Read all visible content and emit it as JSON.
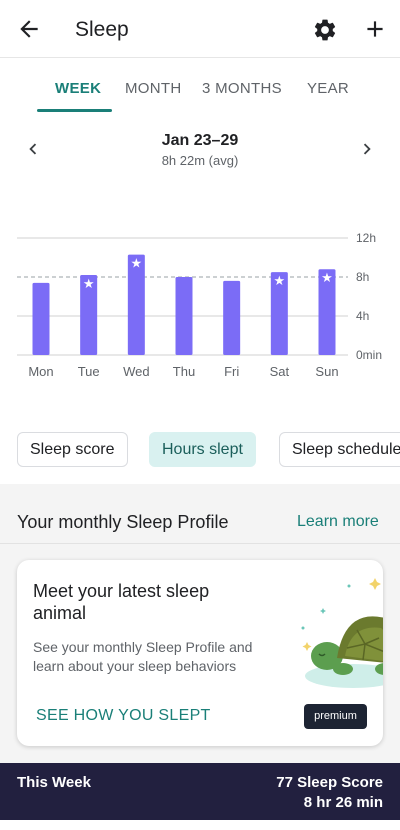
{
  "header": {
    "title": "Sleep"
  },
  "tabs": [
    {
      "label": "WEEK",
      "active": true
    },
    {
      "label": "MONTH",
      "active": false
    },
    {
      "label": "3 MONTHS",
      "active": false
    },
    {
      "label": "YEAR",
      "active": false
    }
  ],
  "range": {
    "label": "Jan 23–29",
    "avg": "8h 22m (avg)"
  },
  "chart_data": {
    "type": "bar",
    "categories": [
      "Mon",
      "Tue",
      "Wed",
      "Thu",
      "Fri",
      "Sat",
      "Sun"
    ],
    "values": [
      7.4,
      8.2,
      10.3,
      8.0,
      7.6,
      8.5,
      8.8
    ],
    "starred": [
      false,
      true,
      true,
      false,
      false,
      true,
      true
    ],
    "y_ticks": [
      "0min",
      "4h",
      "8h",
      "12h"
    ],
    "y_tick_values": [
      0,
      4,
      8,
      12
    ],
    "ylim": [
      0,
      12
    ],
    "reference_line": 8,
    "bar_color": "#7b6cf6",
    "grid": true
  },
  "chips": [
    {
      "label": "Sleep score",
      "active": false
    },
    {
      "label": "Hours slept",
      "active": true
    },
    {
      "label": "Sleep schedule",
      "active": false
    }
  ],
  "profile": {
    "title": "Your monthly Sleep Profile",
    "learn_more": "Learn more"
  },
  "card": {
    "heading": "Meet your latest sleep animal",
    "description": "See your monthly Sleep Profile and learn about your sleep behaviors",
    "cta": "SEE HOW YOU SLEPT",
    "badge": "premium"
  },
  "footer": {
    "left": "This Week",
    "score": "77 Sleep Score",
    "duration": "8 hr 26 min"
  },
  "colors": {
    "accent": "#1a7f78",
    "footer_bg": "#22203f",
    "chip_active_bg": "#d9f1f0"
  }
}
